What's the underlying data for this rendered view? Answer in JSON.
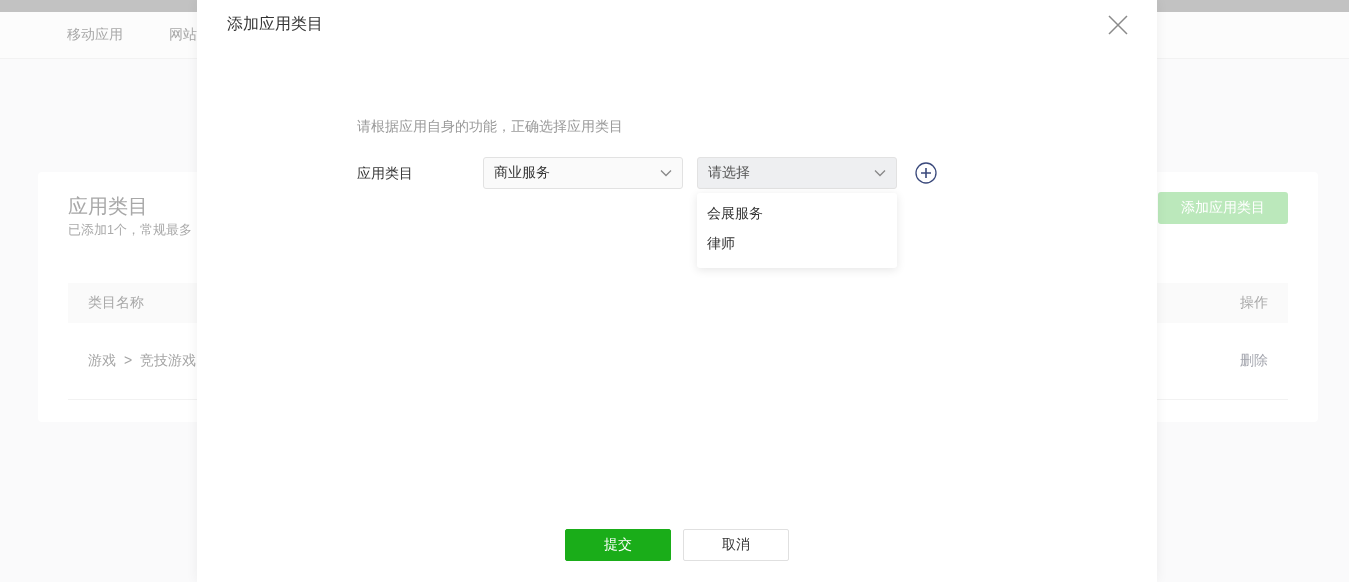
{
  "nav": {
    "tabs": [
      {
        "label": "移动应用",
        "selected": false
      },
      {
        "label": "网站",
        "selected": false
      }
    ]
  },
  "card": {
    "title": "应用类目",
    "subtitle": "已添加1个，常规最多",
    "add_button": "添加应用类目",
    "table": {
      "columns": [
        "类目名称",
        "操作"
      ],
      "rows": [
        {
          "path": [
            "游戏",
            "竞技游戏"
          ],
          "separator": ">",
          "action": "删除"
        }
      ]
    }
  },
  "modal": {
    "title": "添加应用类目",
    "hint": "请根据应用自身的功能，正确选择应用类目",
    "field_label": "应用类目",
    "selects": [
      {
        "value": "商业服务",
        "open": false
      },
      {
        "placeholder": "请选择",
        "open": true,
        "options": [
          {
            "label": "会展服务",
            "selected": false
          },
          {
            "label": "律师",
            "selected": false
          }
        ]
      }
    ],
    "buttons": [
      {
        "label": "提交",
        "kind": "primary"
      },
      {
        "label": "取消",
        "kind": "secondary"
      }
    ]
  }
}
